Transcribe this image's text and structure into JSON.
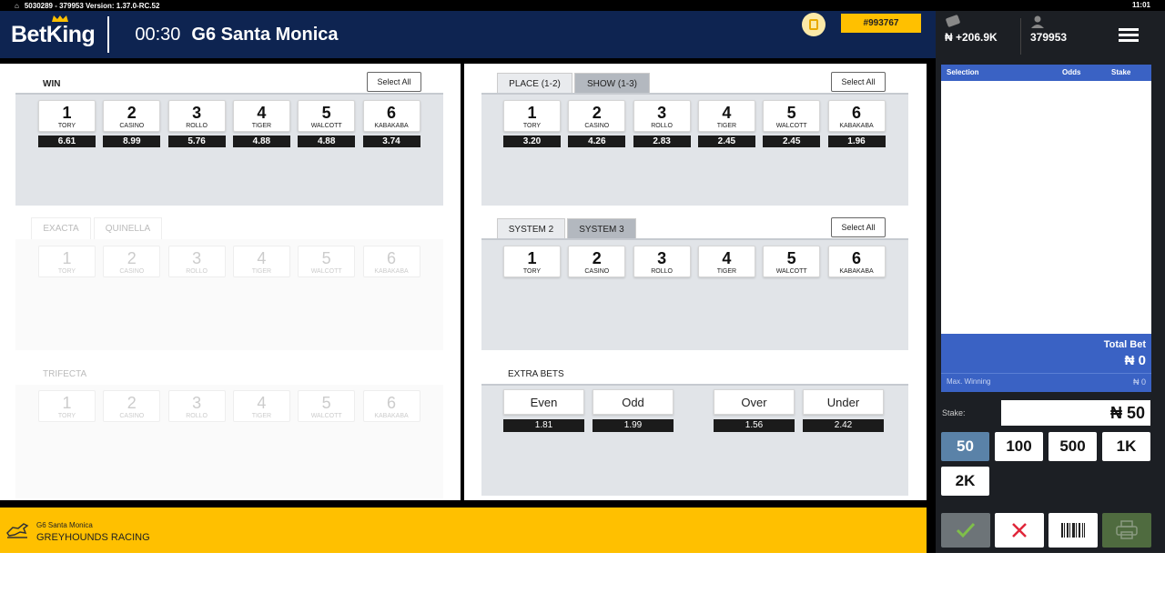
{
  "status_bar": {
    "info": "5030289 - 379953   Version: 1.37.0-RC.52",
    "time": "11:01"
  },
  "header": {
    "logo": "BetKing",
    "race_time": "00:30",
    "race_name": "G6 Santa Monica",
    "ticket_id": "#993767"
  },
  "select_all_label": "Select All",
  "win": {
    "label": "WIN",
    "runners": [
      {
        "num": "1",
        "name": "TORY",
        "odds": "6.61"
      },
      {
        "num": "2",
        "name": "CASINO",
        "odds": "8.99"
      },
      {
        "num": "3",
        "name": "ROLLO",
        "odds": "5.76"
      },
      {
        "num": "4",
        "name": "TIGER",
        "odds": "4.88"
      },
      {
        "num": "5",
        "name": "WALCOTT",
        "odds": "4.88"
      },
      {
        "num": "6",
        "name": "KABAKABA",
        "odds": "3.74"
      }
    ]
  },
  "place_show": {
    "tabs": [
      "PLACE (1-2)",
      "SHOW (1-3)"
    ],
    "odds": [
      "3.20",
      "4.26",
      "2.83",
      "2.45",
      "2.45",
      "1.96"
    ]
  },
  "exacta": {
    "tabs": [
      "EXACTA",
      "QUINELLA"
    ]
  },
  "system": {
    "tabs": [
      "SYSTEM 2",
      "SYSTEM 3"
    ]
  },
  "trifecta": {
    "label": "TRIFECTA"
  },
  "extra_bets": {
    "label": "EXTRA BETS",
    "items": [
      {
        "label": "Even",
        "odds": "1.81"
      },
      {
        "label": "Odd",
        "odds": "1.99"
      },
      {
        "label": "Over",
        "odds": "1.56"
      },
      {
        "label": "Under",
        "odds": "2.42"
      }
    ]
  },
  "footer": {
    "race": "G6 Santa Monica",
    "type": "GREYHOUNDS RACING"
  },
  "account": {
    "balance": "₦ +206.9K",
    "user_id": "379953"
  },
  "slip": {
    "col_selection": "Selection",
    "col_odds": "Odds",
    "col_stake": "Stake",
    "total_label": "Total Bet",
    "total_value": "₦ 0",
    "max_win_label": "Max. Winning",
    "max_win_value": "₦ 0"
  },
  "stake": {
    "label": "Stake:",
    "value": "₦ 50",
    "amounts": [
      "50",
      "100",
      "500",
      "1K",
      "2K"
    ],
    "selected": "50"
  },
  "colors": {
    "header_bg": "#0e2451",
    "accent_yellow": "#ffc000",
    "slip_blue": "#3a62c4",
    "panel_dark": "#1c1f24"
  }
}
